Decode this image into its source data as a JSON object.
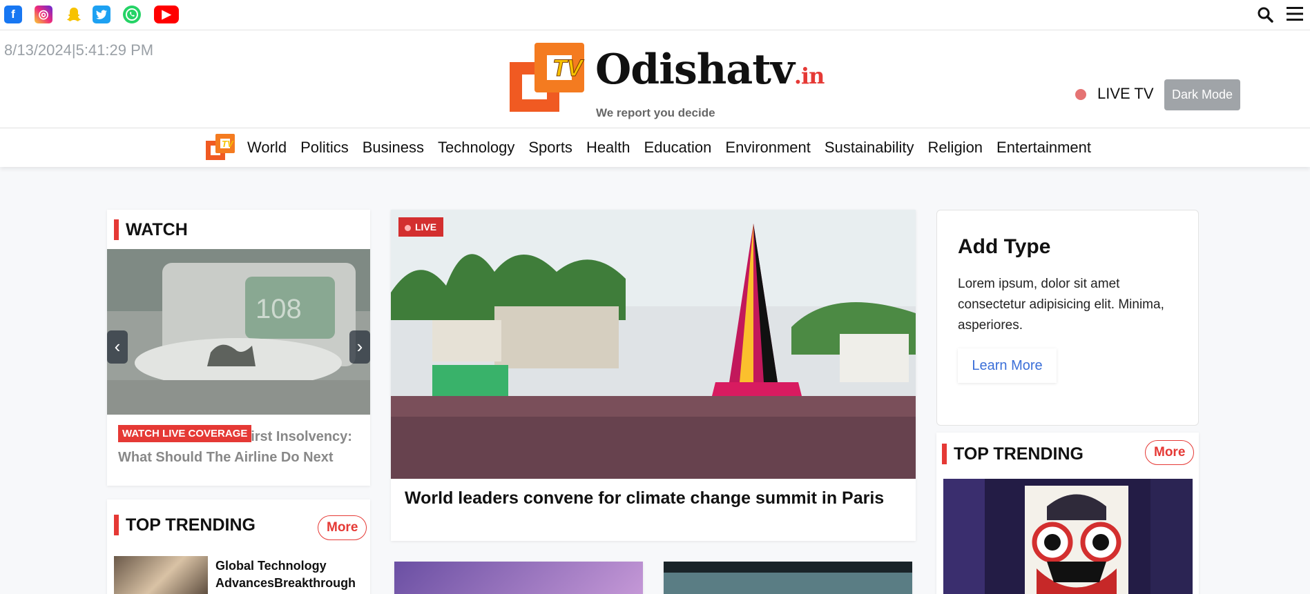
{
  "topbar": {
    "social": [
      {
        "icon": "facebook-icon",
        "glyph": "f",
        "color": "#1877f2"
      },
      {
        "icon": "instagram-icon",
        "glyph": "◎",
        "color": "#ee2a7b"
      },
      {
        "icon": "snapchat-icon",
        "glyph": "",
        "color": "#fffc00"
      },
      {
        "icon": "twitter-icon",
        "glyph": "",
        "color": "#1da1f2"
      },
      {
        "icon": "whatsapp-icon",
        "glyph": "",
        "color": "#25d366"
      },
      {
        "icon": "youtube-icon",
        "glyph": "▶",
        "color": "#ff0000"
      }
    ]
  },
  "header": {
    "datetime": "8/13/2024|5:41:29 PM",
    "logo_word": "Odishatv",
    "logo_suffix": ".in",
    "logo_badge": "TV",
    "tagline": "We report you decide",
    "live_tv": "LIVE TV",
    "dark_mode": "Dark Mode"
  },
  "nav": {
    "items": [
      "World",
      "Politics",
      "Business",
      "Technology",
      "Sports",
      "Health",
      "Education",
      "Environment",
      "Sustainability",
      "Religion",
      "Entertainment"
    ]
  },
  "watch": {
    "title": "WATCH",
    "prev": "‹",
    "next": "›",
    "badge": "WATCH LIVE COVERAGE",
    "headline": "First Insolvency: What Should The Airline Do Next"
  },
  "main_story": {
    "badge": "LIVE",
    "headline": "World leaders convene for climate change summit in Paris"
  },
  "ad": {
    "title": "Add Type",
    "text": "Lorem ipsum, dolor sit amet consectetur adipisicing elit. Minima, asperiores.",
    "button": "Learn More"
  },
  "trending_left": {
    "title": "TOP TRENDING",
    "more": "More",
    "item_title": "Global Technology AdvancesBreakthrough"
  },
  "trending_right": {
    "title": "TOP TRENDING",
    "more": "More"
  },
  "colors": {
    "accent": "#e53935",
    "live_dot": "#e57373",
    "link": "#3b6fd8"
  }
}
